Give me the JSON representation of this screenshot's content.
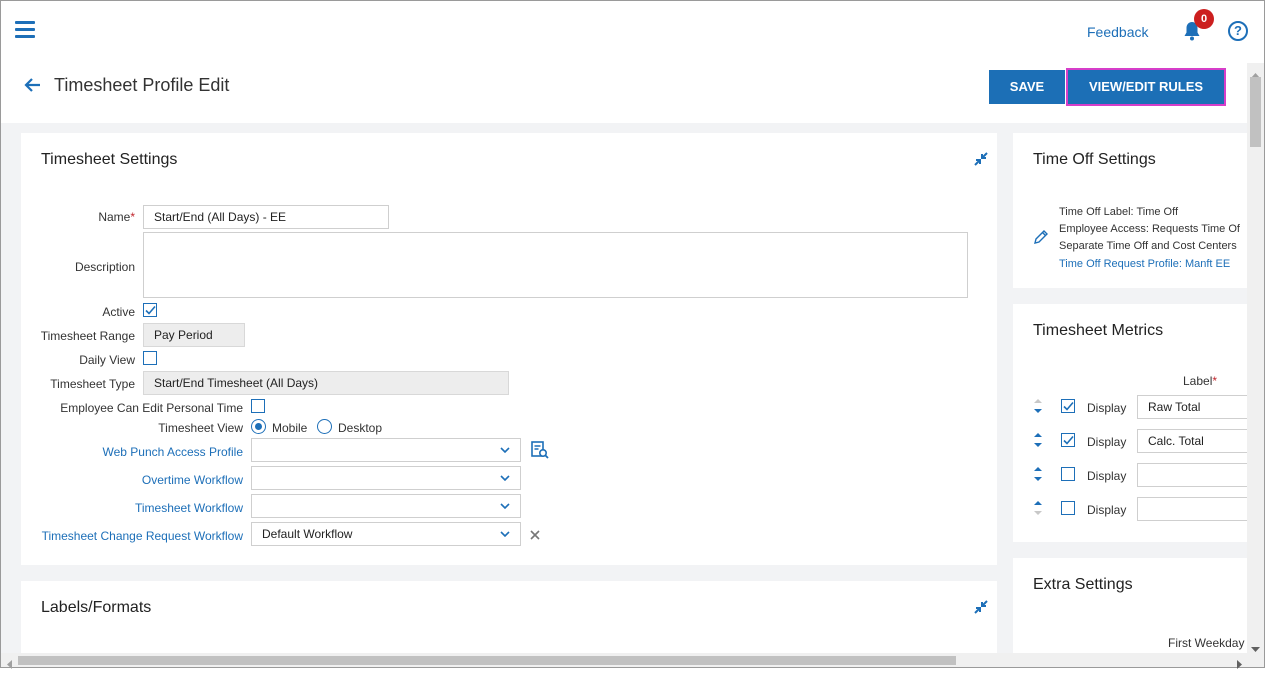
{
  "header": {
    "feedback": "Feedback",
    "notification_count": "0",
    "help": "?"
  },
  "page": {
    "title": "Timesheet Profile Edit",
    "save": "SAVE",
    "rules": "VIEW/EDIT RULES"
  },
  "timesheet_settings": {
    "title": "Timesheet Settings",
    "name_label": "Name",
    "name_required": "*",
    "name_value": "Start/End (All Days) - EE",
    "description_label": "Description",
    "description_value": "",
    "active_label": "Active",
    "active_checked": true,
    "range_label": "Timesheet Range",
    "range_value": "Pay Period",
    "daily_view_label": "Daily View",
    "daily_view_checked": false,
    "type_label": "Timesheet Type",
    "type_value": "Start/End Timesheet (All Days)",
    "edit_personal_label": "Employee Can Edit Personal Time",
    "edit_personal_checked": false,
    "view_label": "Timesheet View",
    "view_mobile": "Mobile",
    "view_desktop": "Desktop",
    "view_selected": "Mobile",
    "web_punch_label": "Web Punch Access Profile",
    "web_punch_value": "",
    "overtime_label": "Overtime Workflow",
    "overtime_value": "",
    "workflow_label": "Timesheet Workflow",
    "workflow_value": "",
    "change_request_label": "Timesheet Change Request Workflow",
    "change_request_value": "Default Workflow"
  },
  "labels_formats": {
    "title": "Labels/Formats"
  },
  "time_off": {
    "title": "Time Off Settings",
    "label_line": {
      "key": "Time Off Label:",
      "value": "Time Off"
    },
    "access_line": {
      "key": "Employee Access:",
      "value": "Requests Time Of"
    },
    "separate_line": {
      "key": "Separate Time Off and Cost Centers",
      "value": ""
    },
    "profile_line": {
      "key": "Time Off Request Profile:",
      "value": "Manft EE"
    }
  },
  "metrics": {
    "title": "Timesheet Metrics",
    "label_header": "Label",
    "label_required": "*",
    "rows": [
      {
        "display": "Display",
        "checked": true,
        "value": "Raw Total"
      },
      {
        "display": "Display",
        "checked": true,
        "value": "Calc. Total"
      },
      {
        "display": "Display",
        "checked": false,
        "value": ""
      },
      {
        "display": "Display",
        "checked": false,
        "value": ""
      }
    ]
  },
  "extra": {
    "title": "Extra Settings",
    "first_weekday": "First Weekday"
  },
  "colors": {
    "primary": "#1c6fb6",
    "highlight": "#d63ec9",
    "badge": "#cc1f1f",
    "required": "#c0262d"
  }
}
